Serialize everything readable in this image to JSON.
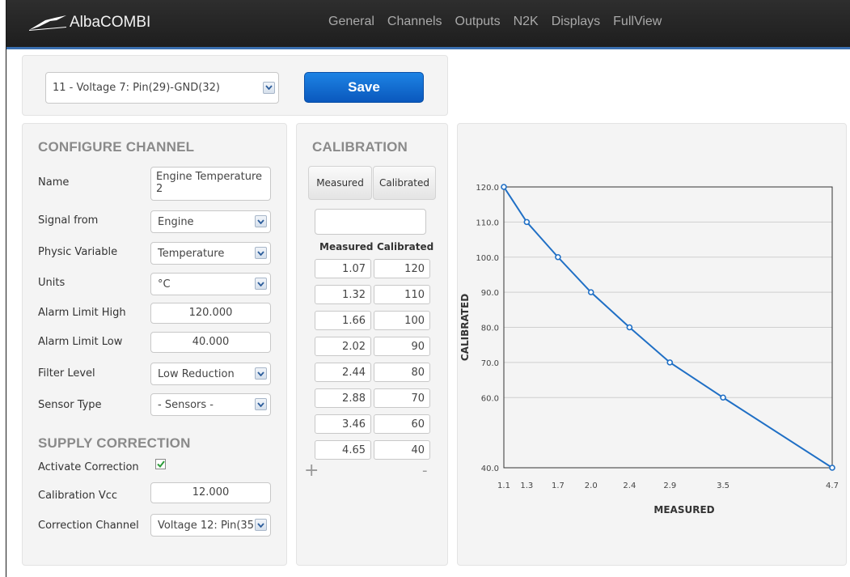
{
  "app": {
    "name": "AlbaCOMBI"
  },
  "nav": [
    "General",
    "Channels",
    "Outputs",
    "N2K",
    "Displays",
    "FullView"
  ],
  "channel_select": {
    "value": "11 - Voltage 7: Pin(29)-GND(32)"
  },
  "save_label": "Save",
  "configure": {
    "title": "CONFIGURE CHANNEL",
    "name_label": "Name",
    "name_value": "Engine Temperature 2",
    "signal_label": "Signal from",
    "signal_value": "Engine",
    "physic_label": "Physic Variable",
    "physic_value": "Temperature",
    "units_label": "Units",
    "units_value": "°C",
    "alarm_high_label": "Alarm Limit High",
    "alarm_high_value": "120.000",
    "alarm_low_label": "Alarm Limit Low",
    "alarm_low_value": "40.000",
    "filter_label": "Filter Level",
    "filter_value": "Low Reduction",
    "sensor_label": "Sensor Type",
    "sensor_value": "- Sensors -"
  },
  "supply": {
    "title": "SUPPLY CORRECTION",
    "activate_label": "Activate Correction",
    "activate_checked": true,
    "vcc_label": "Calibration Vcc",
    "vcc_value": "12.000",
    "channel_label": "Correction Channel",
    "channel_value": "Voltage 12: Pin(35"
  },
  "calibration": {
    "title": "CALIBRATION",
    "tab_measured": "Measured",
    "tab_calibrated": "Calibrated",
    "col_measured": "Measured",
    "col_calibrated": "Calibrated",
    "entry_value": "",
    "rows": [
      {
        "measured": "1.07",
        "calibrated": "120"
      },
      {
        "measured": "1.32",
        "calibrated": "110"
      },
      {
        "measured": "1.66",
        "calibrated": "100"
      },
      {
        "measured": "2.02",
        "calibrated": "90"
      },
      {
        "measured": "2.44",
        "calibrated": "80"
      },
      {
        "measured": "2.88",
        "calibrated": "70"
      },
      {
        "measured": "3.46",
        "calibrated": "60"
      },
      {
        "measured": "4.65",
        "calibrated": "40"
      }
    ],
    "add_symbol": "+",
    "remove_symbol": "-"
  },
  "chart_data": {
    "type": "line",
    "title": "",
    "xlabel": "MEASURED",
    "ylabel": "CALIBRATED",
    "x": [
      1.07,
      1.32,
      1.66,
      2.02,
      2.44,
      2.88,
      3.46,
      4.65
    ],
    "y": [
      120,
      110,
      100,
      90,
      80,
      70,
      60,
      40
    ],
    "x_tick_labels": [
      "1.1",
      "1.3",
      "1.7",
      "2.0",
      "2.4",
      "2.9",
      "3.5",
      "4.7"
    ],
    "y_tick_labels": [
      "120.0",
      "110.0",
      "100.0",
      "90.0",
      "80.0",
      "70.0",
      "60.0",
      "40.0"
    ],
    "grid": "horizontal",
    "line_color": "#1f6fc5"
  }
}
